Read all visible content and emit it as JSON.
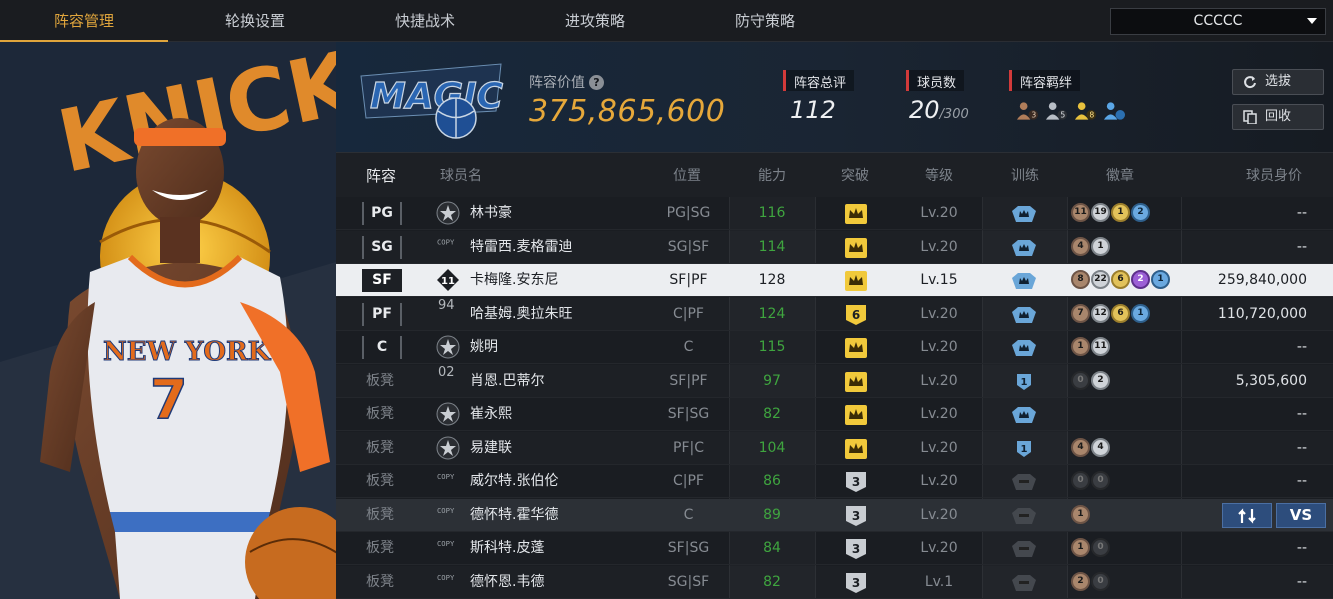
{
  "tabs": [
    {
      "label": "阵容管理",
      "active": true
    },
    {
      "label": "轮换设置",
      "active": false
    },
    {
      "label": "快捷战术",
      "active": false
    },
    {
      "label": "进攻策略",
      "active": false
    },
    {
      "label": "防守策略",
      "active": false
    }
  ],
  "team_select": {
    "value": "CCCCC"
  },
  "header": {
    "value_label": "阵容价值",
    "value": "375,865,600",
    "rating_label": "阵容总评",
    "rating": "112",
    "count_label": "球员数",
    "count": "20",
    "count_max": "/300",
    "bond_label": "阵容羁绊",
    "bonds": [
      "3",
      "5",
      "8",
      ""
    ],
    "btn_scout": "选拔",
    "btn_recycle": "回收"
  },
  "columns": [
    "阵容",
    "球员名",
    "位置",
    "能力",
    "突破",
    "等级",
    "训练",
    "徽章",
    "球员身价"
  ],
  "rows": [
    {
      "slot": "PG",
      "bench": false,
      "icon": "star",
      "name": "林书豪",
      "pos": "PG|SG",
      "ovr": "116",
      "break": "crown",
      "lv": "Lv.20",
      "train": "crown",
      "badges": [
        [
          "11",
          "br"
        ],
        [
          "19",
          "si"
        ],
        [
          "1",
          "go"
        ],
        [
          "2",
          "bl"
        ]
      ],
      "price": "--"
    },
    {
      "slot": "SG",
      "bench": false,
      "icon": "copy",
      "name": "特雷西.麦格雷迪",
      "pos": "SG|SF",
      "ovr": "114",
      "break": "crown",
      "lv": "Lv.20",
      "train": "crown",
      "badges": [
        [
          "4",
          "br"
        ],
        [
          "1",
          "si"
        ]
      ],
      "price": "--"
    },
    {
      "slot": "SF",
      "bench": false,
      "icon": "jersey",
      "name": "卡梅隆.安东尼",
      "pos": "SF|PF",
      "ovr": "128",
      "break": "crown",
      "lv": "Lv.15",
      "train": "crown",
      "badges": [
        [
          "8",
          "br"
        ],
        [
          "22",
          "si"
        ],
        [
          "6",
          "go"
        ],
        [
          "2",
          "pu"
        ],
        [
          "1",
          "bl"
        ]
      ],
      "price": "259,840,000",
      "selected": true
    },
    {
      "slot": "PF",
      "bench": false,
      "icon": "num94",
      "name": "哈基姆.奥拉朱旺",
      "pos": "C|PF",
      "ovr": "124",
      "break": "6",
      "lv": "Lv.20",
      "train": "crown",
      "badges": [
        [
          "7",
          "br"
        ],
        [
          "12",
          "si"
        ],
        [
          "6",
          "go"
        ],
        [
          "1",
          "bl"
        ]
      ],
      "price": "110,720,000"
    },
    {
      "slot": "C",
      "bench": false,
      "icon": "star",
      "name": "姚明",
      "pos": "C",
      "ovr": "115",
      "break": "crown",
      "lv": "Lv.20",
      "train": "crown",
      "badges": [
        [
          "1",
          "br"
        ],
        [
          "11",
          "si"
        ]
      ],
      "price": "--"
    },
    {
      "slot": "板凳",
      "bench": true,
      "icon": "num02",
      "name": "肖恩.巴蒂尔",
      "pos": "SF|PF",
      "ovr": "97",
      "break": "crown",
      "lv": "Lv.20",
      "train": "1",
      "badges": [
        [
          "0",
          "dk"
        ],
        [
          "2",
          "si"
        ]
      ],
      "price": "5,305,600"
    },
    {
      "slot": "板凳",
      "bench": true,
      "icon": "star",
      "name": "崔永熙",
      "pos": "SF|SG",
      "ovr": "82",
      "break": "crown",
      "lv": "Lv.20",
      "train": "crown",
      "badges": [],
      "price": "--"
    },
    {
      "slot": "板凳",
      "bench": true,
      "icon": "star",
      "name": "易建联",
      "pos": "PF|C",
      "ovr": "104",
      "break": "crown",
      "lv": "Lv.20",
      "train": "1",
      "badges": [
        [
          "4",
          "br"
        ],
        [
          "4",
          "si"
        ]
      ],
      "price": "--"
    },
    {
      "slot": "板凳",
      "bench": true,
      "icon": "copy",
      "name": "威尔特.张伯伦",
      "pos": "C|PF",
      "ovr": "86",
      "break": "3",
      "lv": "Lv.20",
      "train": "none",
      "badges": [
        [
          "0",
          "dk"
        ],
        [
          "0",
          "dk"
        ]
      ],
      "price": "--"
    },
    {
      "slot": "板凳",
      "bench": true,
      "icon": "copy",
      "name": "德怀特.霍华德",
      "pos": "C",
      "ovr": "89",
      "break": "3",
      "lv": "Lv.20",
      "train": "none",
      "badges": [
        [
          "1",
          "br"
        ]
      ],
      "price": "",
      "hover": true
    },
    {
      "slot": "板凳",
      "bench": true,
      "icon": "copy",
      "name": "斯科特.皮蓬",
      "pos": "SF|SG",
      "ovr": "84",
      "break": "3",
      "lv": "Lv.20",
      "train": "none",
      "badges": [
        [
          "1",
          "br"
        ],
        [
          "0",
          "dk"
        ]
      ],
      "price": "--"
    },
    {
      "slot": "板凳",
      "bench": true,
      "icon": "copy",
      "name": "德怀恩.韦德",
      "pos": "SG|SF",
      "ovr": "82",
      "break": "3",
      "lv": "Lv.1",
      "train": "none",
      "badges": [
        [
          "2",
          "br"
        ],
        [
          "0",
          "dk"
        ]
      ],
      "price": "--"
    }
  ],
  "row_actions": {
    "swap_icon": "swap-icon",
    "vs_label": "VS"
  },
  "art": {
    "jersey_text": "NEW YORK",
    "jersey_number": "7",
    "bg_text": "KNICKS",
    "logo_text": "MAGIC"
  },
  "colors": {
    "accent": "#e0a53c",
    "ovr_green": "#3fa53f",
    "stat_red": "#d23a3a",
    "action_blue": "#2d4d7c"
  }
}
